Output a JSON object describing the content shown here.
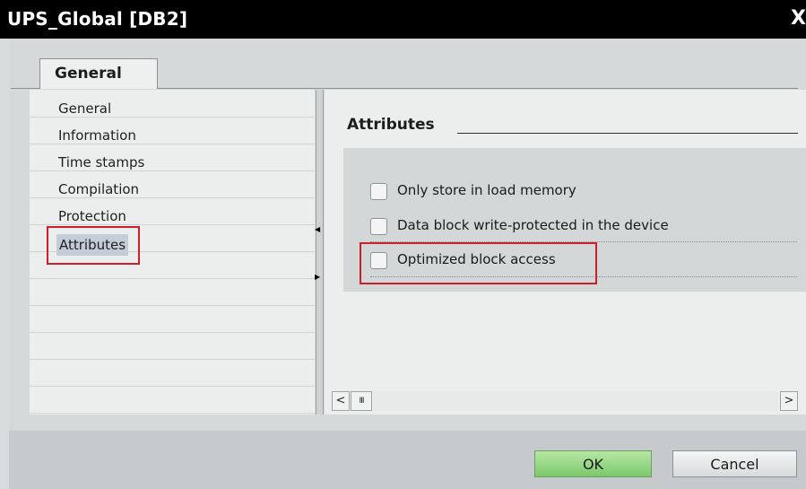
{
  "window": {
    "title": "UPS_Global [DB2]",
    "close_glyph": "X"
  },
  "tabs": [
    {
      "label": "General",
      "selected": true
    }
  ],
  "nav": {
    "items": [
      {
        "label": "General"
      },
      {
        "label": "Information"
      },
      {
        "label": "Time stamps"
      },
      {
        "label": "Compilation"
      },
      {
        "label": "Protection"
      },
      {
        "label": "Attributes",
        "selected": true,
        "highlighted": true
      }
    ]
  },
  "content": {
    "section_title": "Attributes",
    "checkboxes": [
      {
        "label": "Only store in load memory",
        "checked": false
      },
      {
        "label": "Data block write-protected in the device",
        "checked": false
      },
      {
        "label": "Optimized block access",
        "checked": false,
        "highlighted": true
      }
    ]
  },
  "scrollbar": {
    "left_glyph": "<",
    "thumb_glyph": "III",
    "right_glyph": ">"
  },
  "footer": {
    "ok_label": "OK",
    "cancel_label": "Cancel"
  },
  "colors": {
    "highlight_box": "#cc1f2a",
    "ok_button": "#7cc86c",
    "title_bar": "#000000",
    "selected_item": "#c4ccd8"
  }
}
